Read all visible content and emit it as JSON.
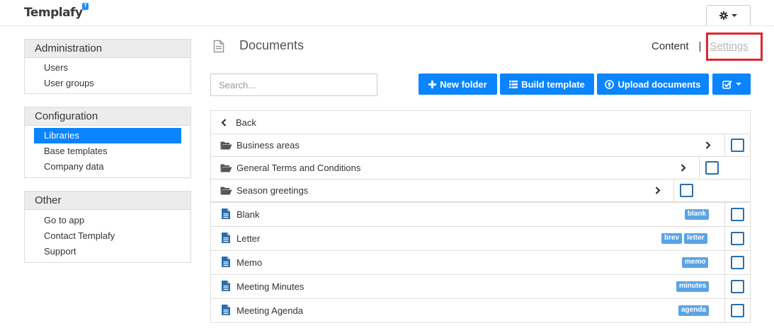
{
  "header": {
    "logo": "Templafy",
    "logo_badge": "T"
  },
  "sidebar": {
    "administration": {
      "title": "Administration",
      "items": [
        "Users",
        "User groups"
      ]
    },
    "configuration": {
      "title": "Configuration",
      "items": [
        "Libraries",
        "Base templates",
        "Company data"
      ],
      "active": "Libraries"
    },
    "other": {
      "title": "Other",
      "items": [
        "Go to app",
        "Contact Templafy",
        "Support"
      ]
    }
  },
  "main": {
    "title": "Documents",
    "nav": {
      "content": "Content",
      "separator": "|",
      "settings": "Settings"
    },
    "search": {
      "placeholder": "Search...",
      "value": ""
    },
    "buttons": {
      "new_folder": "New folder",
      "build_template": "Build template",
      "upload_documents": "Upload documents"
    },
    "list": {
      "back": "Back",
      "folders": [
        "Business areas",
        "General Terms and Conditions",
        "Season greetings"
      ],
      "documents": [
        {
          "name": "Blank",
          "tags": [
            "blank"
          ]
        },
        {
          "name": "Letter",
          "tags": [
            "brev",
            "letter"
          ]
        },
        {
          "name": "Memo",
          "tags": [
            "memo"
          ]
        },
        {
          "name": "Meeting Minutes",
          "tags": [
            "minutes"
          ]
        },
        {
          "name": "Meeting Agenda",
          "tags": [
            "agenda"
          ]
        }
      ]
    }
  },
  "colors": {
    "primary": "#0a84ff",
    "tag": "#5aa3e8",
    "highlight": "#e0242c",
    "checkbox": "#2b6ea8"
  }
}
